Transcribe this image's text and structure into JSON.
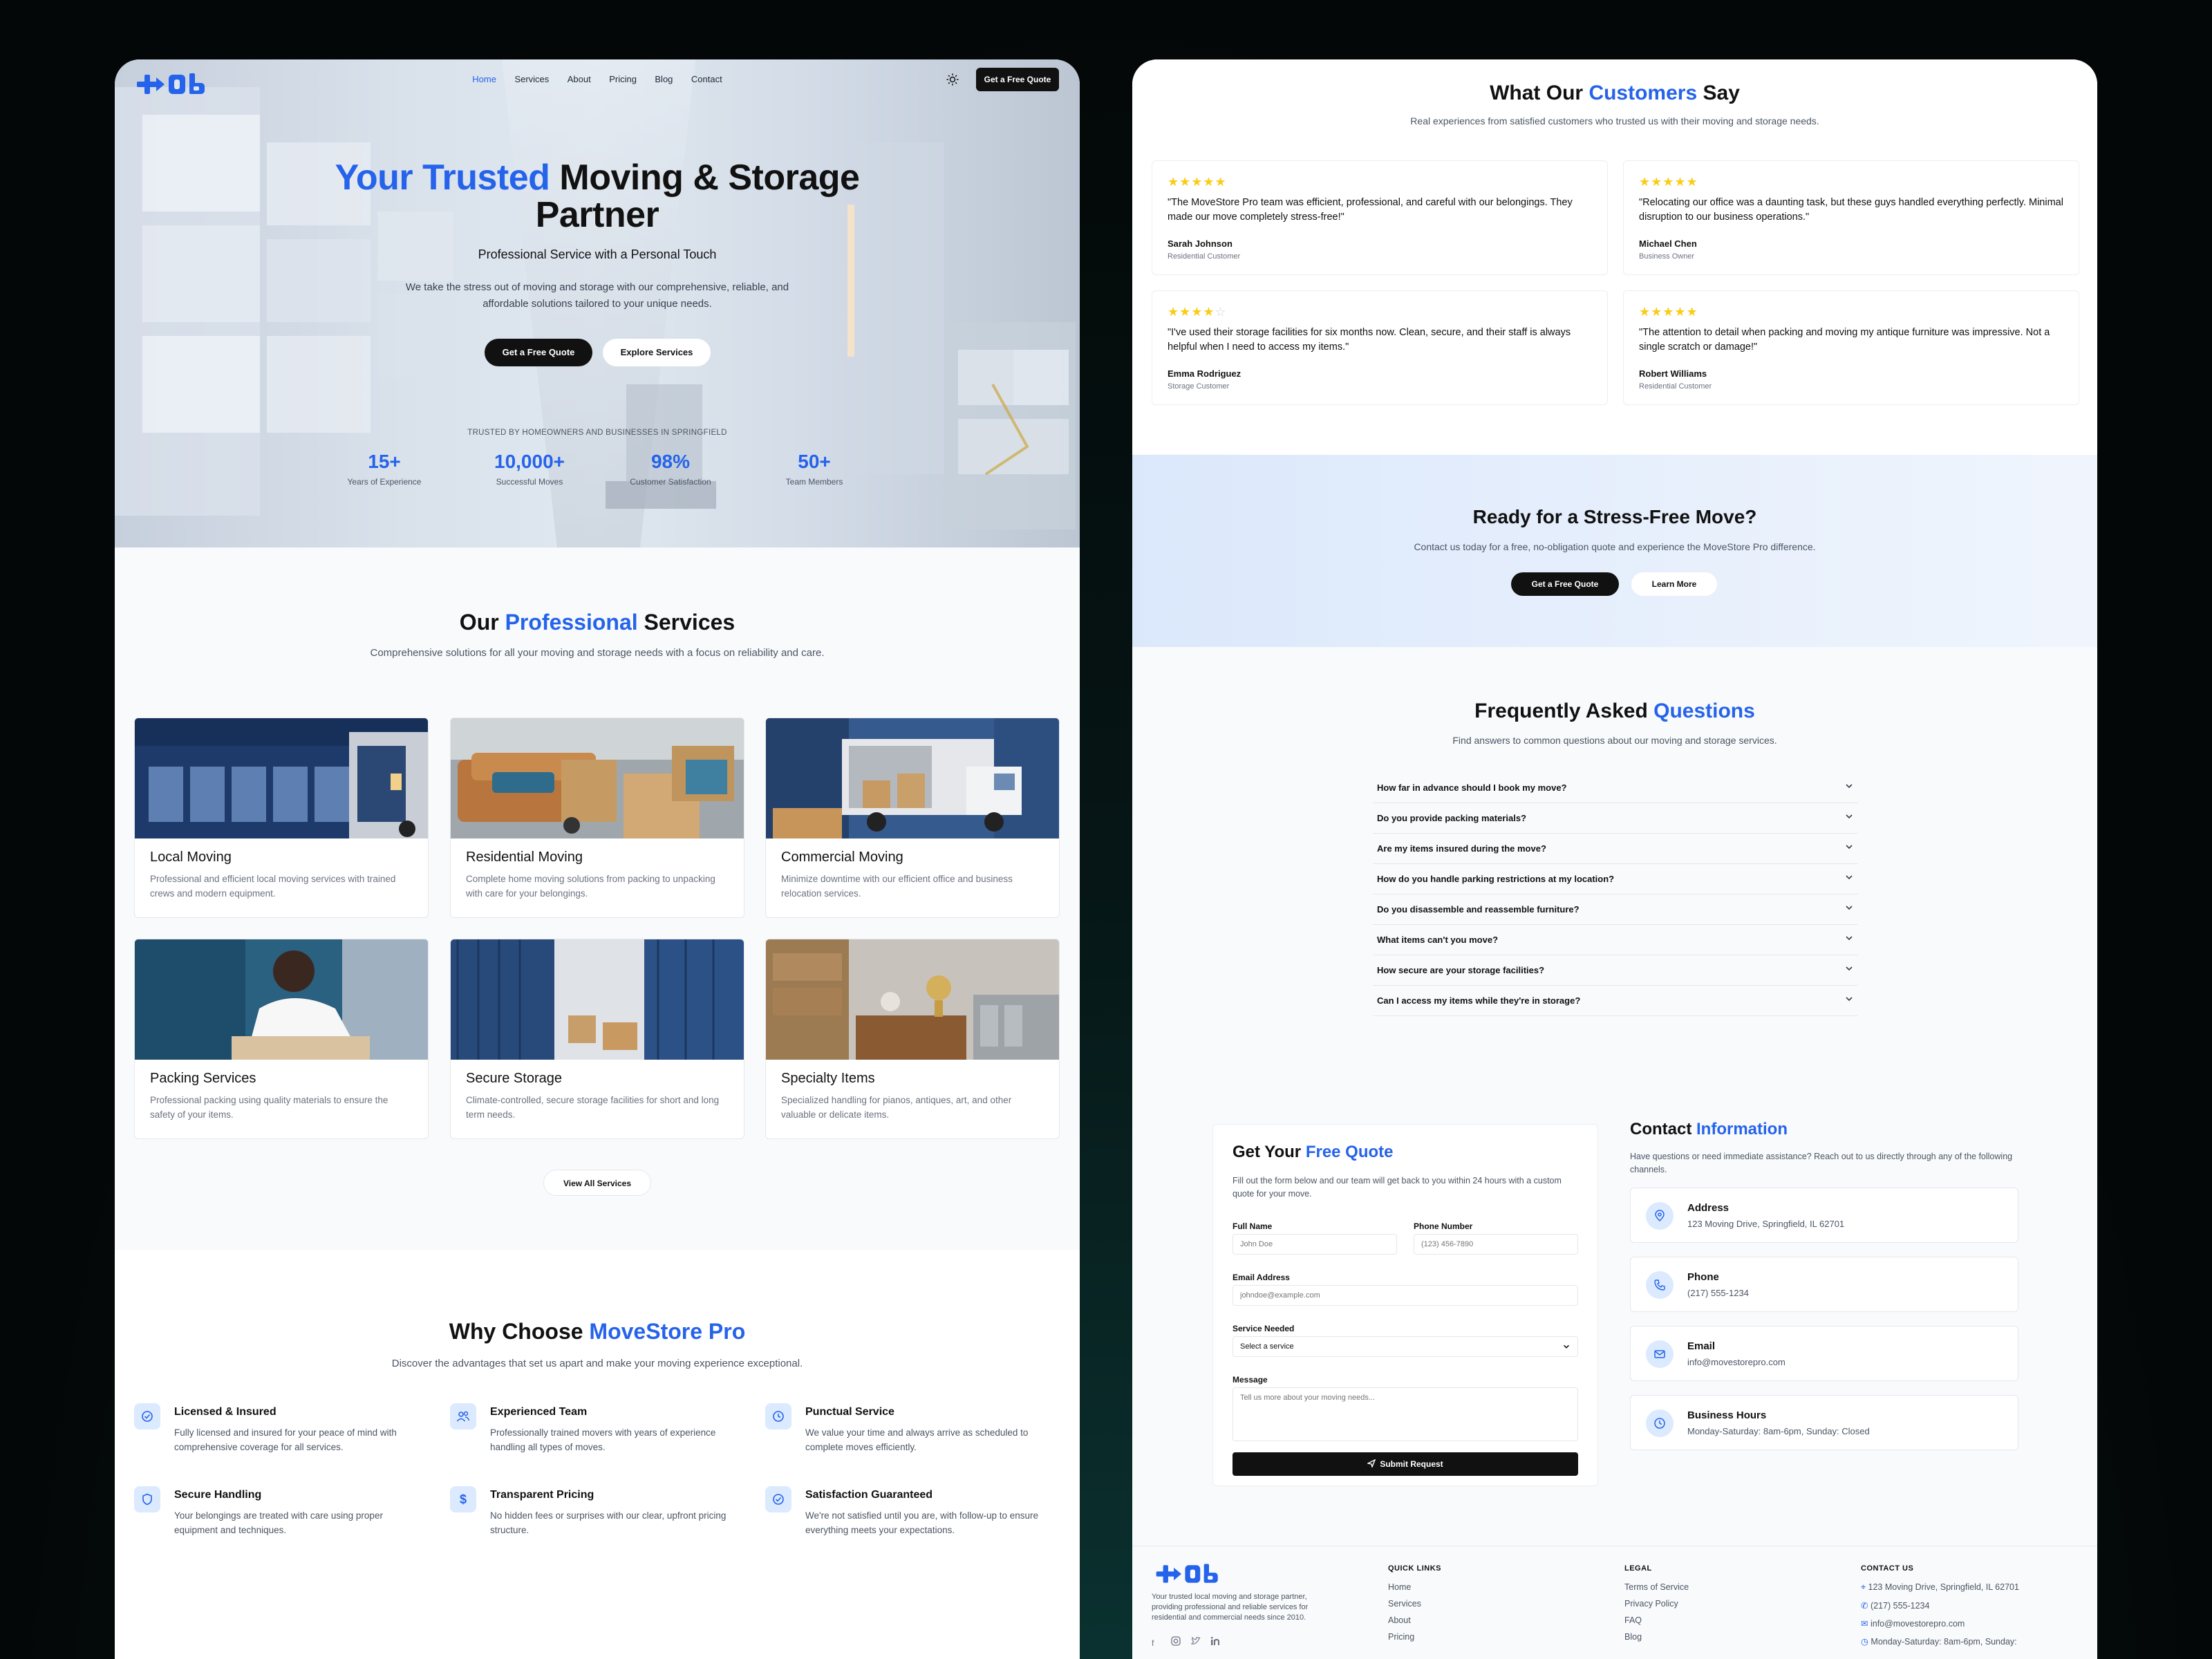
{
  "colors": {
    "accent": "#2563eb",
    "dark": "#111111",
    "star": "#facc15",
    "icon_bg": "#dbeafe"
  },
  "nav": {
    "items": [
      "Home",
      "Services",
      "About",
      "Pricing",
      "Blog",
      "Contact"
    ],
    "active": "Home",
    "theme_toggle_icon": "sun-icon",
    "cta": "Get a Free Quote"
  },
  "hero": {
    "title_highlight": "Your Trusted",
    "title_rest_line1": "Moving & Storage",
    "title_line2": "Partner",
    "tagline": "Professional Service with a Personal Touch",
    "description": "We take the stress out of moving and storage with our comprehensive, reliable, and affordable solutions tailored to your unique needs.",
    "primary_button": "Get a Free Quote",
    "secondary_button": "Explore Services",
    "trusted_by": "TRUSTED BY HOMEOWNERS AND BUSINESSES IN SPRINGFIELD",
    "stats": [
      {
        "value": "15+",
        "label": "Years of Experience"
      },
      {
        "value": "10,000+",
        "label": "Successful Moves"
      },
      {
        "value": "98%",
        "label": "Customer Satisfaction"
      },
      {
        "value": "50+",
        "label": "Team Members"
      }
    ]
  },
  "services": {
    "title_pre": "Our",
    "title_highlight": "Professional",
    "title_post": "Services",
    "subtitle": "Comprehensive solutions for all your moving and storage needs with a focus on reliability and care.",
    "cards": [
      {
        "title": "Local Moving",
        "desc": "Professional and efficient local moving services with trained crews and modern equipment."
      },
      {
        "title": "Residential Moving",
        "desc": "Complete home moving solutions from packing to unpacking with care for your belongings."
      },
      {
        "title": "Commercial Moving",
        "desc": "Minimize downtime with our efficient office and business relocation services."
      },
      {
        "title": "Packing Services",
        "desc": "Professional packing using quality materials to ensure the safety of your items."
      },
      {
        "title": "Secure Storage",
        "desc": "Climate-controlled, secure storage facilities for short and long term needs."
      },
      {
        "title": "Specialty Items",
        "desc": "Specialized handling for pianos, antiques, art, and other valuable or delicate items."
      }
    ],
    "view_all": "View All Services"
  },
  "why": {
    "title_pre": "Why Choose",
    "title_highlight": "MoveStore Pro",
    "subtitle": "Discover the advantages that set us apart and make your moving experience exceptional.",
    "features": [
      {
        "icon": "check-circle-icon",
        "title": "Licensed & Insured",
        "desc": "Fully licensed and insured for your peace of mind with comprehensive coverage for all services."
      },
      {
        "icon": "users-icon",
        "title": "Experienced Team",
        "desc": "Professionally trained movers with years of experience handling all types of moves."
      },
      {
        "icon": "clock-icon",
        "title": "Punctual Service",
        "desc": "We value your time and always arrive as scheduled to complete moves efficiently."
      },
      {
        "icon": "shield-icon",
        "title": "Secure Handling",
        "desc": "Your belongings are treated with care using proper equipment and techniques."
      },
      {
        "icon": "dollar-icon",
        "title": "Transparent Pricing",
        "desc": "No hidden fees or surprises with our clear, upfront pricing structure."
      },
      {
        "icon": "check-circle-icon",
        "title": "Satisfaction Guaranteed",
        "desc": "We're not satisfied until you are, with follow-up to ensure everything meets your expectations."
      }
    ]
  },
  "testimonials": {
    "title_pre": "What Our",
    "title_highlight": "Customers",
    "title_post": "Say",
    "subtitle": "Real experiences from satisfied customers who trusted us with their moving and storage needs.",
    "items": [
      {
        "rating": 5,
        "quote": "\"The MoveStore Pro team was efficient, professional, and careful with our belongings. They made our move completely stress-free!\"",
        "name": "Sarah Johnson",
        "role": "Residential Customer"
      },
      {
        "rating": 5,
        "quote": "\"Relocating our office was a daunting task, but these guys handled everything perfectly. Minimal disruption to our business operations.\"",
        "name": "Michael Chen",
        "role": "Business Owner"
      },
      {
        "rating": 4,
        "quote": "\"I've used their storage facilities for six months now. Clean, secure, and their staff is always helpful when I need to access my items.\"",
        "name": "Emma Rodriguez",
        "role": "Storage Customer"
      },
      {
        "rating": 5,
        "quote": "\"The attention to detail when packing and moving my antique furniture was impressive. Not a single scratch or damage!\"",
        "name": "Robert Williams",
        "role": "Residential Customer"
      }
    ]
  },
  "cta": {
    "title": "Ready for a Stress-Free Move?",
    "subtitle": "Contact us today for a free, no-obligation quote and experience the MoveStore Pro difference.",
    "primary": "Get a Free Quote",
    "secondary": "Learn More"
  },
  "faq": {
    "title_pre": "Frequently Asked",
    "title_highlight": "Questions",
    "subtitle": "Find answers to common questions about our moving and storage services.",
    "items": [
      "How far in advance should I book my move?",
      "Do you provide packing materials?",
      "Are my items insured during the move?",
      "How do you handle parking restrictions at my location?",
      "Do you disassemble and reassemble furniture?",
      "What items can't you move?",
      "How secure are your storage facilities?",
      "Can I access my items while they're in storage?"
    ]
  },
  "quote_form": {
    "title_pre": "Get Your",
    "title_highlight": "Free Quote",
    "subtitle": "Fill out the form below and our team will get back to you within 24 hours with a custom quote for your move.",
    "full_name_label": "Full Name",
    "full_name_placeholder": "John Doe",
    "phone_label": "Phone Number",
    "phone_placeholder": "(123) 456-7890",
    "email_label": "Email Address",
    "email_placeholder": "johndoe@example.com",
    "service_label": "Service Needed",
    "service_selected": "Select a service",
    "message_label": "Message",
    "message_placeholder": "Tell us more about your moving needs...",
    "submit": "Submit Request"
  },
  "contact": {
    "title_pre": "Contact",
    "title_highlight": "Information",
    "subtitle": "Have questions or need immediate assistance? Reach out to us directly through any of the following channels.",
    "items": [
      {
        "icon": "map-pin-icon",
        "title": "Address",
        "value": "123 Moving Drive, Springfield, IL 62701"
      },
      {
        "icon": "phone-icon",
        "title": "Phone",
        "value": "(217) 555-1234"
      },
      {
        "icon": "mail-icon",
        "title": "Email",
        "value": "info@movestorepro.com"
      },
      {
        "icon": "clock-icon",
        "title": "Business Hours",
        "value": "Monday-Saturday: 8am-6pm, Sunday: Closed"
      }
    ]
  },
  "footer": {
    "about": "Your trusted local moving and storage partner, providing professional and reliable services for residential and commercial needs since 2010.",
    "social_icons": [
      "facebook-icon",
      "instagram-icon",
      "twitter-icon",
      "linkedin-icon"
    ],
    "quick_links_heading": "QUICK LINKS",
    "quick_links": [
      "Home",
      "Services",
      "About",
      "Pricing"
    ],
    "legal_heading": "LEGAL",
    "legal_links": [
      "Terms of Service",
      "Privacy Policy",
      "FAQ",
      "Blog"
    ],
    "contact_heading": "CONTACT US",
    "contact_lines": [
      "123 Moving Drive, Springfield, IL 62701",
      "(217) 555-1234",
      "info@movestorepro.com",
      "Monday-Saturday: 8am-6pm, Sunday:"
    ]
  }
}
